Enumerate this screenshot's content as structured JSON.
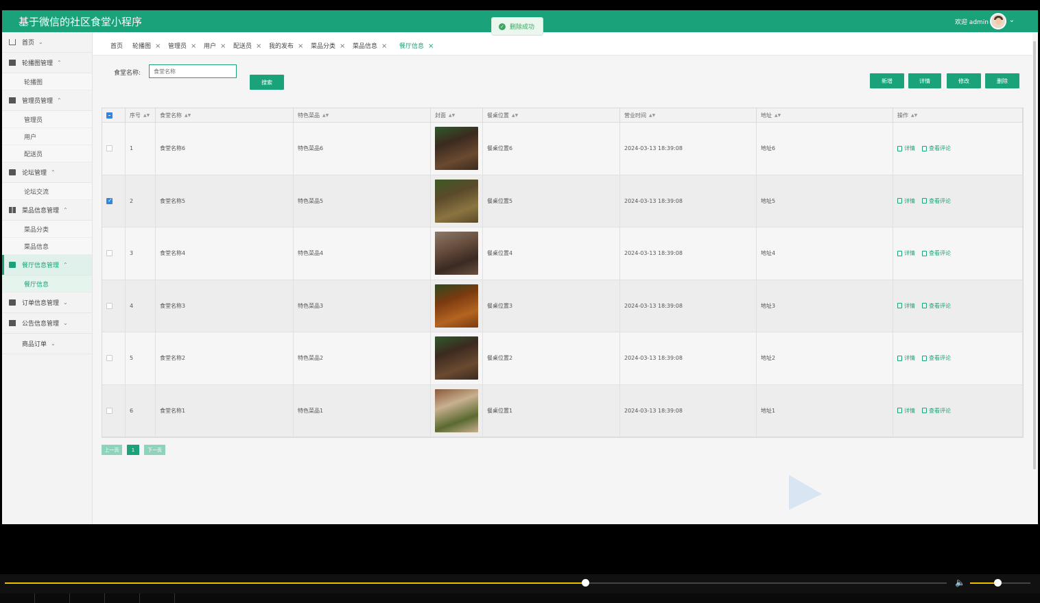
{
  "app_title": "基于微信的社区食堂小程序",
  "user": {
    "welcome": "欢迎 admin"
  },
  "toast": {
    "text": "删除成功"
  },
  "sidebar": [
    {
      "label": "首页",
      "icon": "home-icon",
      "chevron": "⌄"
    },
    {
      "label": "轮播图管理",
      "icon": "carousel-icon",
      "chevron": "⌃",
      "children": [
        "轮播图"
      ]
    },
    {
      "label": "管理员管理",
      "icon": "admin-icon",
      "chevron": "⌃",
      "children": [
        "管理员",
        "用户",
        "配送员"
      ]
    },
    {
      "label": "论坛管理",
      "icon": "forum-icon",
      "chevron": "⌃",
      "children": [
        "论坛交流"
      ]
    },
    {
      "label": "菜品信息管理",
      "icon": "dish-icon",
      "chevron": "⌃",
      "children": [
        "菜品分类",
        "菜品信息"
      ]
    },
    {
      "label": "餐厅信息管理",
      "icon": "restaurant-icon",
      "chevron": "⌃",
      "children": [
        "餐厅信息"
      ],
      "active": true
    },
    {
      "label": "订单信息管理",
      "icon": "order-icon",
      "chevron": "⌄"
    },
    {
      "label": "公告信息管理",
      "icon": "notice-icon",
      "chevron": "⌄"
    },
    {
      "label": "商品订单",
      "icon": "",
      "chevron": "⌄"
    }
  ],
  "tabs": [
    "首页",
    "轮播图",
    "管理员",
    "用户",
    "配送员",
    "我的发布",
    "菜品分类",
    "菜品信息",
    "餐厅信息"
  ],
  "search": {
    "label": "食堂名称:",
    "placeholder": "食堂名称",
    "button": "搜索"
  },
  "actions": {
    "add": "新增",
    "detail": "详情",
    "edit": "修改",
    "delete": "删除"
  },
  "table": {
    "headers": [
      "序号",
      "食堂名称",
      "特色菜品",
      "封面",
      "餐桌位置",
      "营业时间",
      "地址",
      "操作"
    ],
    "rows": [
      {
        "no": "1",
        "name": "食堂名称6",
        "dish": "特色菜品6",
        "pos": "餐桌位置6",
        "time": "2024-03-13 18:39:08",
        "addr": "地址6",
        "checked": false
      },
      {
        "no": "2",
        "name": "食堂名称5",
        "dish": "特色菜品5",
        "pos": "餐桌位置5",
        "time": "2024-03-13 18:39:08",
        "addr": "地址5",
        "checked": true
      },
      {
        "no": "3",
        "name": "食堂名称4",
        "dish": "特色菜品4",
        "pos": "餐桌位置4",
        "time": "2024-03-13 18:39:08",
        "addr": "地址4",
        "checked": false
      },
      {
        "no": "4",
        "name": "食堂名称3",
        "dish": "特色菜品3",
        "pos": "餐桌位置3",
        "time": "2024-03-13 18:39:08",
        "addr": "地址3",
        "checked": false
      },
      {
        "no": "5",
        "name": "食堂名称2",
        "dish": "特色菜品2",
        "pos": "餐桌位置2",
        "time": "2024-03-13 18:39:08",
        "addr": "地址2",
        "checked": false
      },
      {
        "no": "6",
        "name": "食堂名称1",
        "dish": "特色菜品1",
        "pos": "餐桌位置1",
        "time": "2024-03-13 18:39:08",
        "addr": "地址1",
        "checked": false
      }
    ],
    "row_ops": {
      "detail": "详情",
      "comments": "查看评论"
    }
  },
  "pagination": {
    "prev": "上一页",
    "page": "1",
    "next": "下一页"
  },
  "colors": {
    "primary": "#1aa37a",
    "checkbox": "#2f86e4",
    "progress": "#f0c000"
  },
  "player": {
    "progress": 0.616,
    "volume": 0.45
  }
}
